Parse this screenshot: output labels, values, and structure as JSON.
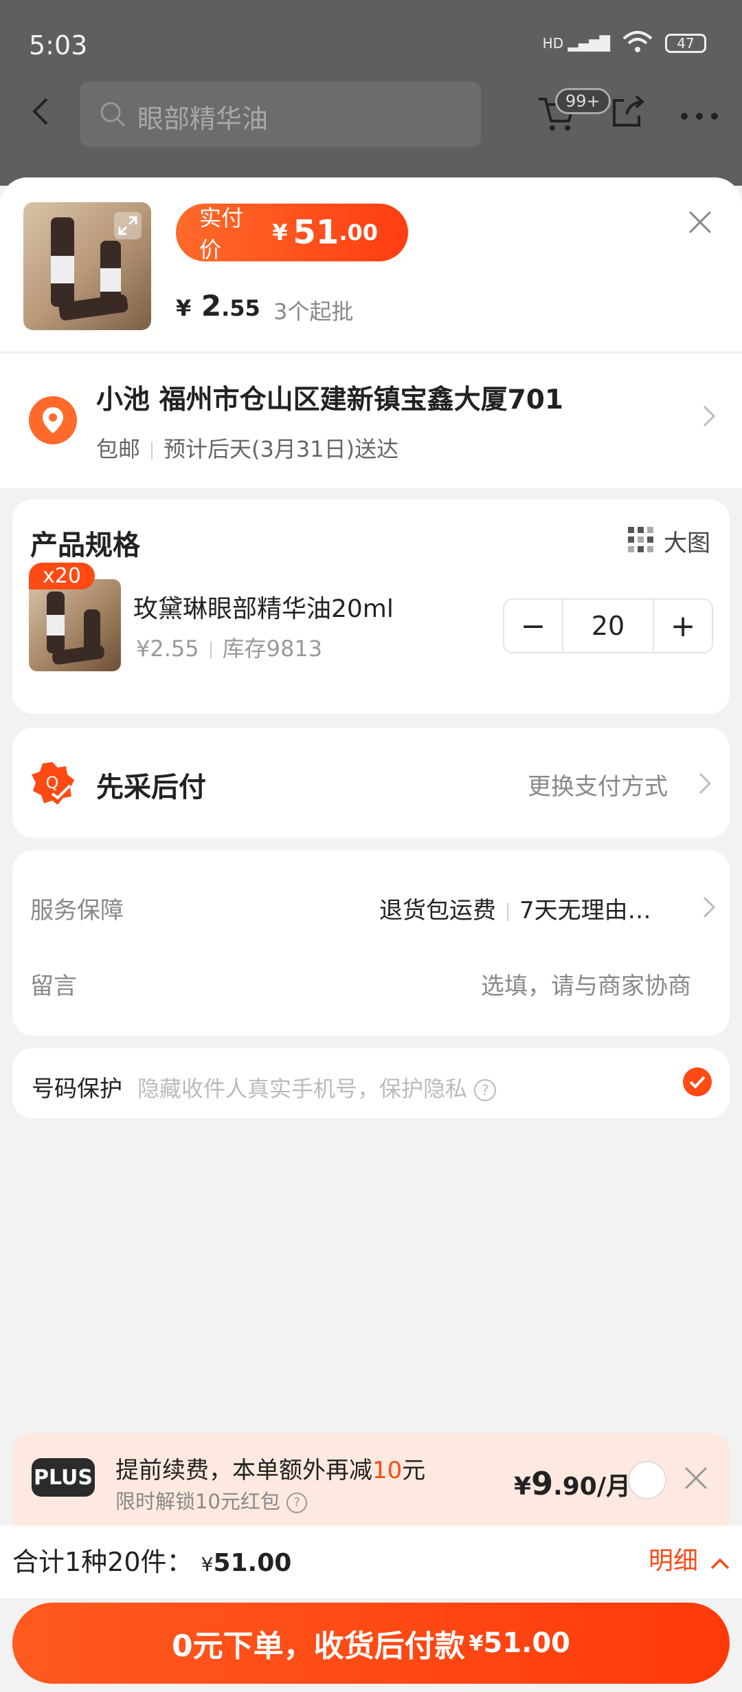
{
  "status": {
    "time": "5:03",
    "hd": "HD",
    "battery": "47"
  },
  "topbar": {
    "search_placeholder": "眼部精华油",
    "cart_badge": "99+"
  },
  "header": {
    "paid_label": "实付价",
    "paid_currency": "¥",
    "paid_int": "51",
    "paid_dec": ".00",
    "unit_currency": "¥",
    "unit_int": "2",
    "unit_dec": ".55",
    "moq": "3个起批"
  },
  "address": {
    "title": "小池 福州市仓山区建新镇宝鑫大厦701",
    "shipping": "包邮",
    "eta": "预计后天(3月31日)送达"
  },
  "spec": {
    "title": "产品规格",
    "big_image": "大图",
    "badge": "x20",
    "name": "玫黛琳眼部精华油20ml",
    "price": "¥2.55",
    "stock": "库存9813",
    "qty": "20",
    "minus": "−",
    "plus": "+"
  },
  "payment": {
    "title": "先采后付",
    "change": "更换支付方式"
  },
  "service": {
    "label": "服务保障",
    "item1": "退货包运费",
    "item2": "7天无理由…",
    "msg_label": "留言",
    "msg_placeholder": "选填，请与商家协商"
  },
  "protect": {
    "label": "号码保护",
    "desc": "隐藏收件人真实手机号，保护隐私"
  },
  "plus": {
    "badge": "PLUS",
    "title_a": "提前续费，本单额外再减",
    "title_hl": "10",
    "title_b": "元",
    "sub": "限时解锁10元红包",
    "price_cur": "¥",
    "price_int": "9",
    "price_rest": ".90/月"
  },
  "summary": {
    "label": "合计1种20件：",
    "currency": "¥",
    "amount": "51.00",
    "detail": "明细"
  },
  "cta": {
    "label": "0元下单，收货后付款",
    "currency": "¥",
    "amount": "51.00"
  },
  "colors": {
    "accent": "#ff4a14",
    "accent2": "#ff6a2a"
  }
}
